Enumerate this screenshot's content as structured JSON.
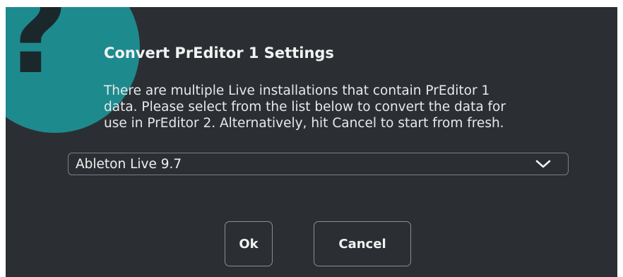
{
  "dialog": {
    "icon": "question-mark-icon",
    "icon_glyph": "?",
    "icon_color": "#1d8a8e",
    "title": "Convert PrEditor 1 Settings",
    "message_lines": [
      "There are multiple Live installations that contain PrEditor 1",
      "data. Please select from the list below to convert the data for",
      "use in PrEditor 2. Alternatively, hit Cancel to start from fresh."
    ],
    "select": {
      "value": "Ableton Live 9.7",
      "icon": "chevron-down-icon"
    },
    "buttons": {
      "ok_label": "Ok",
      "cancel_label": "Cancel"
    },
    "background_color": "#2b2f34"
  }
}
